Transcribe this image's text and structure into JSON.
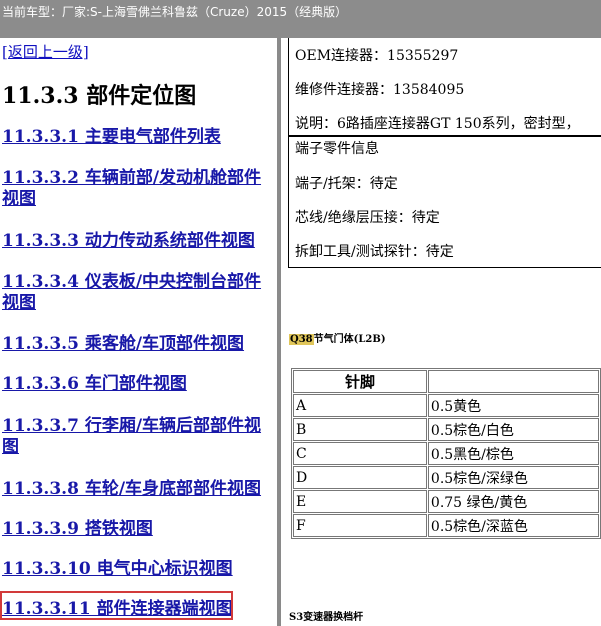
{
  "header": {
    "title": "当前车型：厂家:S-上海雪佛兰科鲁兹（Cruze）2015（经典版）"
  },
  "nav": {
    "back_link": "[返回上一级]",
    "section_title": "11.3.3 部件定位图",
    "items": [
      "11.3.3.1 主要电气部件列表",
      "11.3.3.2 车辆前部/发动机舱部件视图",
      "11.3.3.3 动力传动系统部件视图",
      "11.3.3.4 仪表板/中央控制台部件视图",
      "11.3.3.5 乘客舱/车顶部件视图",
      "11.3.3.6 车门部件视图",
      "11.3.3.7 行李厢/车辆后部部件视图",
      "11.3.3.8 车轮/车身底部部件视图",
      "11.3.3.9 搭铁视图",
      "11.3.3.10 电气中心标识视图",
      "11.3.3.11 部件连接器端视图"
    ]
  },
  "content": {
    "connector_info": [
      "OEM连接器：15355297",
      "维修件连接器：13584095",
      "说明：6路插座连接器GT 150系列，密封型，"
    ],
    "terminal_info": [
      "端子零件信息",
      "端子/托架：待定",
      "芯线/绝缘层压接：待定",
      "拆卸工具/测试探针：待定"
    ],
    "q38_caption": {
      "code": "Q38",
      "label": "节气门体(L2B)"
    },
    "pin_table": {
      "header": "针脚",
      "rows": [
        {
          "pin": "A",
          "color": "0.5黄色"
        },
        {
          "pin": "B",
          "color": "0.5棕色/白色"
        },
        {
          "pin": "C",
          "color": "0.5黑色/棕色"
        },
        {
          "pin": "D",
          "color": "0.5棕色/深绿色"
        },
        {
          "pin": "E",
          "color": "0.75 绿色/黄色"
        },
        {
          "pin": "F",
          "color": "0.5棕色/深蓝色"
        }
      ]
    },
    "s3_caption": "S3变速器换档杆"
  }
}
